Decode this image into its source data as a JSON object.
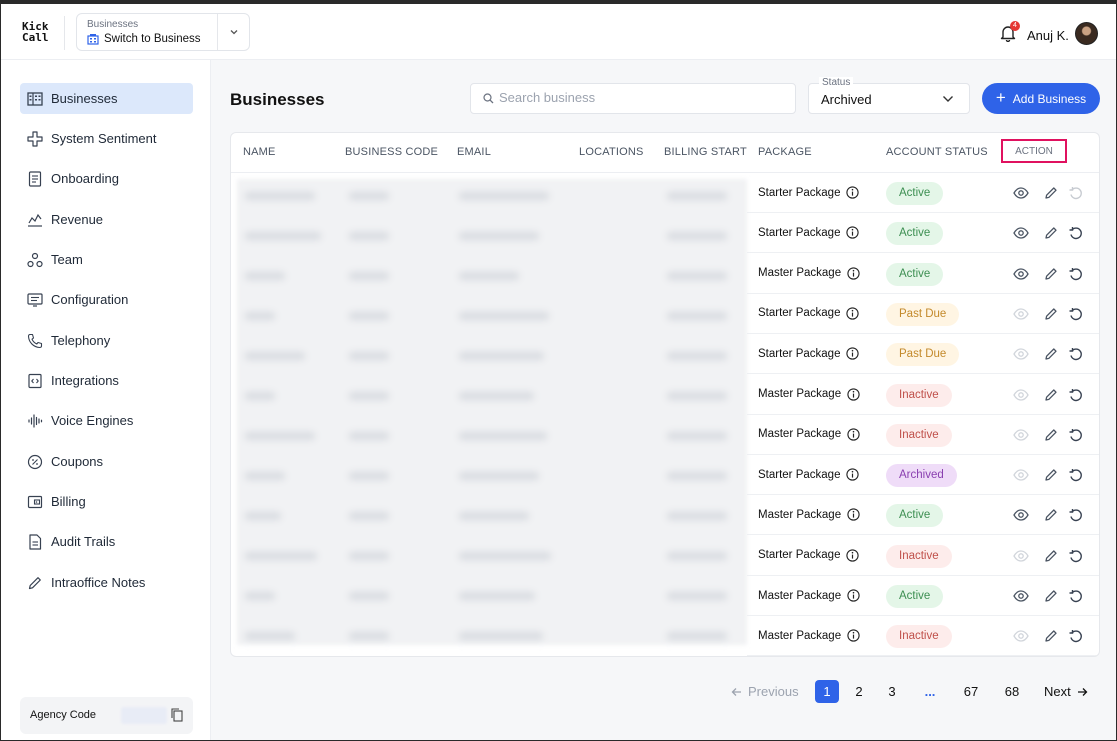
{
  "logo": {
    "line1": "Kick",
    "line2": "Call"
  },
  "switcher": {
    "caption": "Businesses",
    "label": "Switch to Business"
  },
  "notifications": {
    "count": "4"
  },
  "user": {
    "name": "Anuj K."
  },
  "sidebar": {
    "items": [
      {
        "label": "Businesses",
        "icon": "building-icon"
      },
      {
        "label": "System Sentiment",
        "icon": "sentiment-icon"
      },
      {
        "label": "Onboarding",
        "icon": "document-icon"
      },
      {
        "label": "Revenue",
        "icon": "revenue-icon"
      },
      {
        "label": "Team",
        "icon": "team-icon"
      },
      {
        "label": "Configuration",
        "icon": "configuration-icon"
      },
      {
        "label": "Telephony",
        "icon": "phone-icon"
      },
      {
        "label": "Integrations",
        "icon": "integrations-icon"
      },
      {
        "label": "Voice Engines",
        "icon": "voice-wave-icon"
      },
      {
        "label": "Coupons",
        "icon": "coupon-icon"
      },
      {
        "label": "Billing",
        "icon": "wallet-icon"
      },
      {
        "label": "Audit Trails",
        "icon": "file-icon"
      },
      {
        "label": "Intraoffice Notes",
        "icon": "pencil-icon"
      }
    ],
    "agency_code_label": "Agency Code"
  },
  "page": {
    "title": "Businesses",
    "search_placeholder": "Search business",
    "status_label": "Status",
    "status_value": "Archived",
    "add_button": "Add Business"
  },
  "table": {
    "headers": {
      "name": "NAME",
      "business_code": "BUSINESS CODE",
      "email": "EMAIL",
      "locations": "LOCATIONS",
      "billing_start": "BILLING START",
      "package": "PACKAGE",
      "account_status": "ACCOUNT STATUS",
      "action": "ACTION"
    },
    "rows": [
      {
        "package": "Starter Package",
        "status": "Active",
        "kind": "active"
      },
      {
        "package": "Starter Package",
        "status": "Active",
        "kind": "active"
      },
      {
        "package": "Master Package",
        "status": "Active",
        "kind": "active"
      },
      {
        "package": "Starter Package",
        "status": "Past Due",
        "kind": "pastdue"
      },
      {
        "package": "Starter Package",
        "status": "Past Due",
        "kind": "pastdue"
      },
      {
        "package": "Master Package",
        "status": "Inactive",
        "kind": "inactive"
      },
      {
        "package": "Master Package",
        "status": "Inactive",
        "kind": "inactive"
      },
      {
        "package": "Starter Package",
        "status": "Archived",
        "kind": "archived"
      },
      {
        "package": "Master Package",
        "status": "Active",
        "kind": "active"
      },
      {
        "package": "Starter Package",
        "status": "Inactive",
        "kind": "inactive"
      },
      {
        "package": "Master Package",
        "status": "Active",
        "kind": "active"
      },
      {
        "package": "Master Package",
        "status": "Inactive",
        "kind": "inactive"
      }
    ]
  },
  "pagination": {
    "previous": "Previous",
    "next": "Next",
    "pages": [
      "1",
      "2",
      "3",
      "...",
      "67",
      "68"
    ],
    "current": "1"
  },
  "colors": {
    "accent": "#2f63e8",
    "active_bg": "#e4f6e8",
    "pastdue_bg": "#fff5e3",
    "inactive_bg": "#fdeceb",
    "archived_bg": "#efdcf8",
    "highlight_border": "#e0115f"
  }
}
